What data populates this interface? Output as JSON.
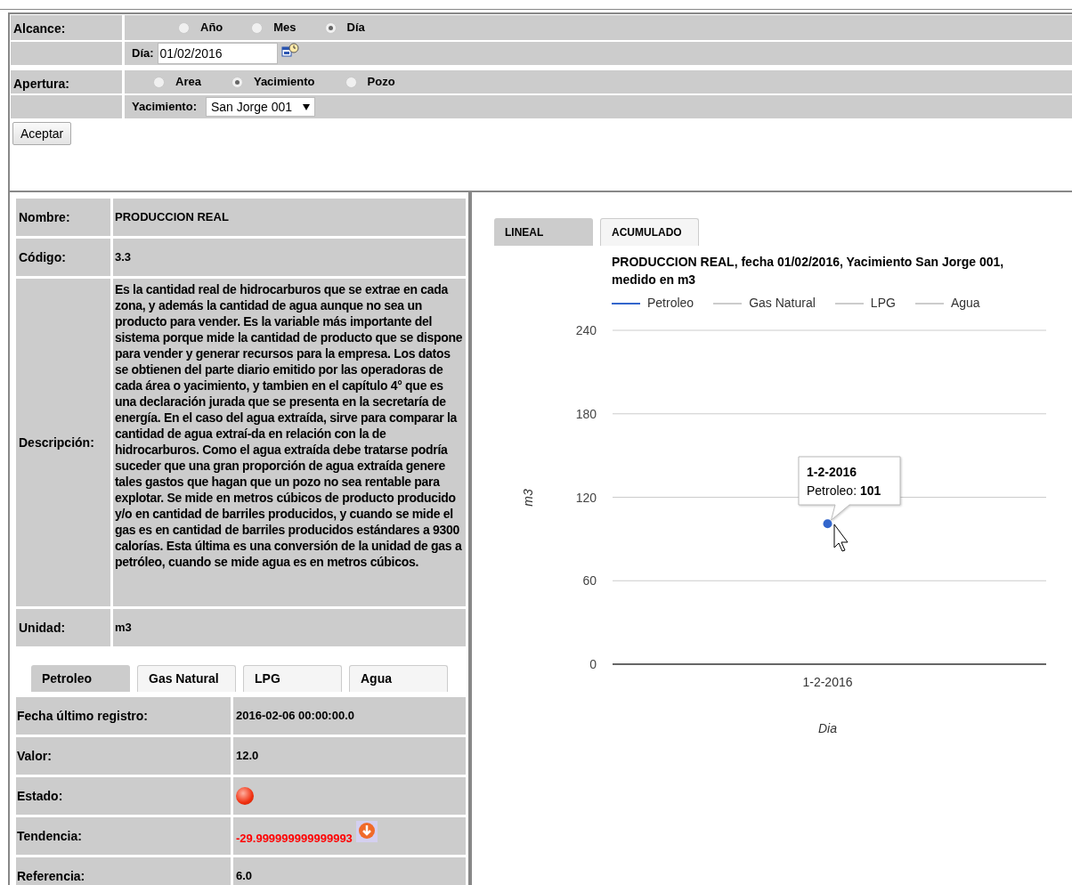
{
  "form": {
    "scope": {
      "label": "Alcance:",
      "options": [
        {
          "label": "Año",
          "selected": false
        },
        {
          "label": "Mes",
          "selected": false
        },
        {
          "label": "Día",
          "selected": true
        }
      ]
    },
    "date": {
      "label": "Día:",
      "value": "01/02/2016"
    },
    "opening": {
      "label": "Apertura:",
      "options": [
        {
          "label": "Area",
          "selected": false
        },
        {
          "label": "Yacimiento",
          "selected": true
        },
        {
          "label": "Pozo",
          "selected": false
        }
      ]
    },
    "field": {
      "label": "Yacimiento:",
      "value": "San Jorge 001"
    },
    "submit": "Aceptar"
  },
  "details": [
    {
      "label": "Nombre:",
      "value": "PRODUCCION REAL"
    },
    {
      "label": "Código:",
      "value": "3.3"
    },
    {
      "label": "Descripción:",
      "value": "Es la cantidad real de hidrocarburos que se extrae en cada zona, y además la cantidad de agua aunque no sea un producto para vender. Es la variable más importante del sistema porque mide la cantidad de producto que se dispone para vender y generar recursos para la empresa. Los datos se obtienen del parte diario emitido por las operadoras de cada área o yacimiento, y tambien en el capítulo 4° que es una declaración jurada que se presenta en la secretaría de energía. En el caso del agua extraída, sirve para comparar la cantidad de agua extraí-da en relación con la de hidrocarburos. Como el agua extraída debe tratarse podría suceder que una gran proporción de agua extraída genere tales gastos que hagan que un pozo no sea rentable para explotar. Se mide en metros cúbicos de producto producido y/o en cantidad de barriles producidos, y cuando se mide el gas es en cantidad de barriles producidos estándares a 9300 calorías. Esta última es una conversión de la unidad de gas a petróleo, cuando se mide agua es en metros cúbicos."
    },
    {
      "label": "Unidad:",
      "value": "m3"
    }
  ],
  "product_tabs": [
    {
      "label": "Petroleo",
      "selected": true
    },
    {
      "label": "Gas Natural",
      "selected": false
    },
    {
      "label": "LPG",
      "selected": false
    },
    {
      "label": "Agua",
      "selected": false
    }
  ],
  "indicators": [
    {
      "kind": "text",
      "label": "Fecha último registro:",
      "value": "2016-02-06 00:00:00.0"
    },
    {
      "kind": "text",
      "label": "Valor:",
      "value": "12.0"
    },
    {
      "kind": "status",
      "label": "Estado:"
    },
    {
      "kind": "trend",
      "label": "Tendencia:",
      "value": "-29.999999999999993"
    },
    {
      "kind": "text",
      "label": "Referencia:",
      "value": "6.0"
    }
  ],
  "chart_tabs": [
    {
      "label": "LINEAL",
      "selected": true
    },
    {
      "label": "ACUMULADO",
      "selected": false
    }
  ],
  "chart": {
    "chart_data": {
      "type": "line",
      "title": "PRODUCCION REAL, fecha 01/02/2016, Yacimiento San Jorge 001, medido en m3",
      "xlabel": "Dia",
      "ylabel": "m3",
      "categories": [
        "1-2-2016"
      ],
      "series": [
        {
          "name": "Petroleo",
          "color": "#3366cc",
          "marker": "circle",
          "values": [
            101
          ]
        },
        {
          "name": "Gas Natural",
          "color": "#cccccc",
          "values": [
            null
          ]
        },
        {
          "name": "LPG",
          "color": "#cccccc",
          "values": [
            null
          ]
        },
        {
          "name": "Agua",
          "color": "#cccccc",
          "values": [
            null
          ]
        }
      ],
      "ylim": [
        0,
        240
      ],
      "yticks": [
        0,
        60,
        120,
        180,
        240
      ]
    },
    "tooltip": {
      "title": "1-2-2016",
      "series": "Petroleo:",
      "value": "101"
    }
  }
}
